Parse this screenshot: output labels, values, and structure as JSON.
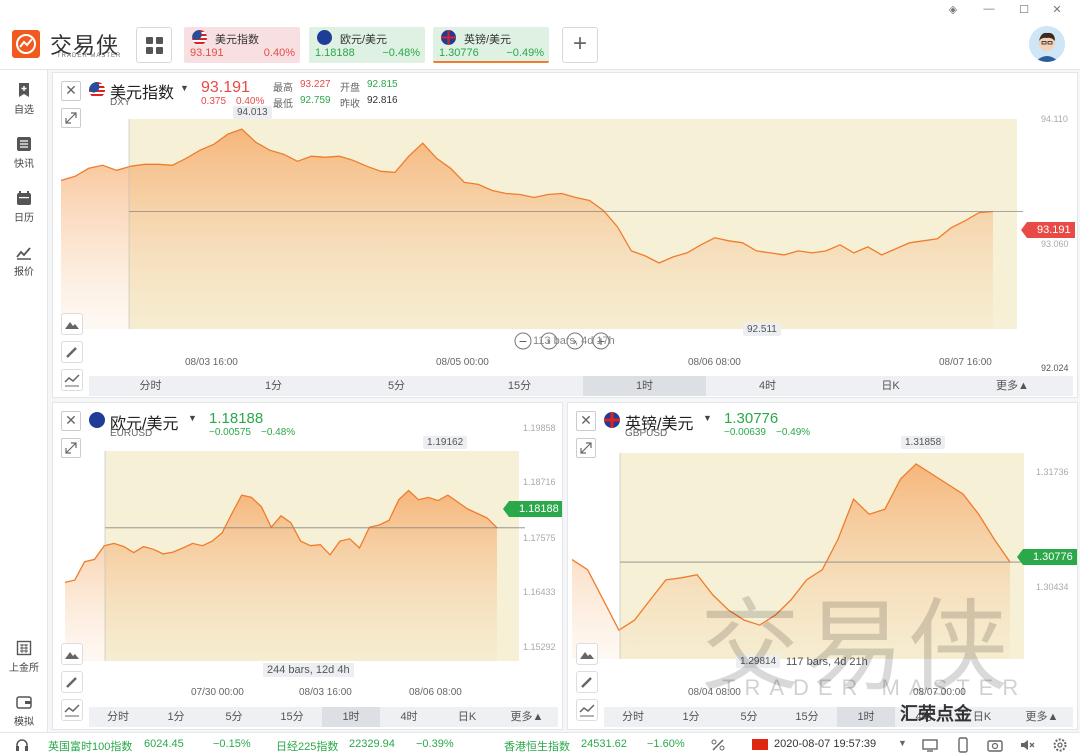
{
  "app": {
    "logo_cn": "交易侠",
    "logo_en": "TRADER MASTER",
    "watermark_cn": "交易侠",
    "watermark_en": "TRADER MASTER",
    "wechat_mark": "汇荣点金"
  },
  "tabs": [
    {
      "name": "美元指数",
      "price": "93.191",
      "change": "0.40%",
      "color": "#e84b46"
    },
    {
      "name": "欧元/美元",
      "price": "1.18188",
      "change": "−0.48%",
      "color": "#2aa84a"
    },
    {
      "name": "英镑/美元",
      "price": "1.30776",
      "change": "−0.49%",
      "color": "#2aa84a"
    }
  ],
  "sidebar": [
    {
      "label": "自选",
      "icon": "bookmark-add-icon"
    },
    {
      "label": "快讯",
      "icon": "news-list-icon"
    },
    {
      "label": "日历",
      "icon": "calendar-icon"
    },
    {
      "label": "报价",
      "icon": "line-chart-icon"
    },
    {
      "label": "上金所",
      "icon": "exchange-building-icon"
    },
    {
      "label": "模拟",
      "icon": "wallet-icon"
    }
  ],
  "timeframes": [
    "分时",
    "1分",
    "5分",
    "15分",
    "1时",
    "4时",
    "日K",
    "更多▲"
  ],
  "dxy": {
    "name": "美元指数",
    "code": "DXY",
    "price": "93.191",
    "change": "0.375",
    "change_pct": "0.40%",
    "high_label": "最高",
    "high": "93.227",
    "open_label": "开盘",
    "open": "92.815",
    "low_label": "最低",
    "low": "92.759",
    "prev_label": "昨收",
    "prev": "92.816",
    "max_callout": "94.013",
    "min_callout": "92.511",
    "bars_info": "113 bars, 4d 17h",
    "y_ticks": [
      "94.110",
      "93.060",
      "92.024"
    ],
    "x_ticks": [
      "08/03 16:00",
      "08/05 00:00",
      "08/06 08:00",
      "08/07 16:00"
    ],
    "tag": "93.191"
  },
  "eurusd": {
    "name": "欧元/美元",
    "code": "EURUSD",
    "price": "1.18188",
    "change": "−0.00575",
    "change_pct": "−0.48%",
    "max_callout": "1.19162",
    "bars_info": "244 bars, 12d 4h",
    "y_ticks": [
      "1.19858",
      "1.18716",
      "1.17575",
      "1.16433",
      "1.15292"
    ],
    "x_ticks": [
      "07/30 00:00",
      "08/03 16:00",
      "08/06 08:00"
    ],
    "tag": "1.18188"
  },
  "gbpusd": {
    "name": "英镑/美元",
    "code": "GBPUSD",
    "price": "1.30776",
    "change": "−0.00639",
    "change_pct": "−0.49%",
    "max_callout": "1.31858",
    "min_callout": "1.29814",
    "bars_info": "117 bars, 4d 21h",
    "y_ticks": [
      "1.31736",
      "1.30434"
    ],
    "x_ticks": [
      "08/04 08:00",
      "08/07 00:00"
    ],
    "tag": "1.30776"
  },
  "statusbar": {
    "ftse_name": "英国富时100指数",
    "ftse_val": "6024.45",
    "ftse_chg": "−0.15%",
    "nikkei_name": "日经225指数",
    "nikkei_val": "22329.94",
    "nikkei_chg": "−0.39%",
    "hsi_name": "香港恒生指数",
    "hsi_val": "24531.62",
    "hsi_chg": "−1.60%",
    "datetime": "2020-08-07 19:57:39"
  },
  "chart_data": [
    {
      "type": "area",
      "title": "美元指数 DXY",
      "x_ticks": [
        "08/03 16:00",
        "08/05 00:00",
        "08/06 08:00",
        "08/07 16:00"
      ],
      "ylim": [
        92.024,
        94.11
      ],
      "values": [
        93.5,
        93.54,
        93.62,
        93.65,
        93.6,
        93.64,
        93.66,
        93.66,
        93.65,
        93.72,
        93.8,
        93.86,
        93.96,
        94.01,
        93.88,
        93.8,
        93.76,
        93.69,
        93.74,
        93.73,
        93.74,
        93.7,
        93.64,
        93.59,
        93.58,
        93.74,
        93.87,
        93.72,
        93.62,
        93.48,
        93.46,
        93.4,
        93.37,
        93.36,
        93.33,
        93.36,
        93.37,
        93.33,
        93.3,
        93.2,
        93.04,
        92.8,
        92.75,
        92.68,
        92.74,
        92.78,
        92.86,
        92.93,
        92.9,
        92.88,
        92.8,
        92.78,
        92.76,
        92.8,
        92.78,
        92.8,
        92.86,
        92.78,
        92.84,
        92.76,
        92.82,
        92.88,
        92.9,
        92.92,
        93.03,
        93.1,
        93.18,
        93.191
      ],
      "grid": false
    },
    {
      "type": "area",
      "title": "欧元/美元 EURUSD",
      "x_ticks": [
        "07/30 00:00",
        "08/03 16:00",
        "08/06 08:00"
      ],
      "ylim": [
        1.15292,
        1.19858
      ],
      "values": [
        1.17,
        1.1705,
        1.1745,
        1.175,
        1.178,
        1.1785,
        1.1778,
        1.1765,
        1.1778,
        1.1772,
        1.1762,
        1.1766,
        1.1775,
        1.1785,
        1.178,
        1.179,
        1.1808,
        1.185,
        1.189,
        1.1885,
        1.1865,
        1.182,
        1.1845,
        1.183,
        1.179,
        1.178,
        1.1782,
        1.176,
        1.179,
        1.1795,
        1.1775,
        1.182,
        1.1825,
        1.1835,
        1.188,
        1.19,
        1.188,
        1.1885,
        1.1878,
        1.189,
        1.1875,
        1.186,
        1.185,
        1.184,
        1.18188
      ],
      "grid": false
    },
    {
      "type": "area",
      "title": "英镑/美元 GBPUSD",
      "x_ticks": [
        "08/04 08:00",
        "08/07 00:00"
      ],
      "ylim": [
        1.29814,
        1.31858
      ],
      "values": [
        1.308,
        1.307,
        1.304,
        1.301,
        1.302,
        1.304,
        1.306,
        1.3062,
        1.3065,
        1.3045,
        1.303,
        1.302,
        1.3015,
        1.3025,
        1.304,
        1.306,
        1.307,
        1.31,
        1.314,
        1.3125,
        1.313,
        1.316,
        1.3175,
        1.3165,
        1.3155,
        1.3145,
        1.3125,
        1.31,
        1.30776
      ],
      "grid": false
    }
  ]
}
